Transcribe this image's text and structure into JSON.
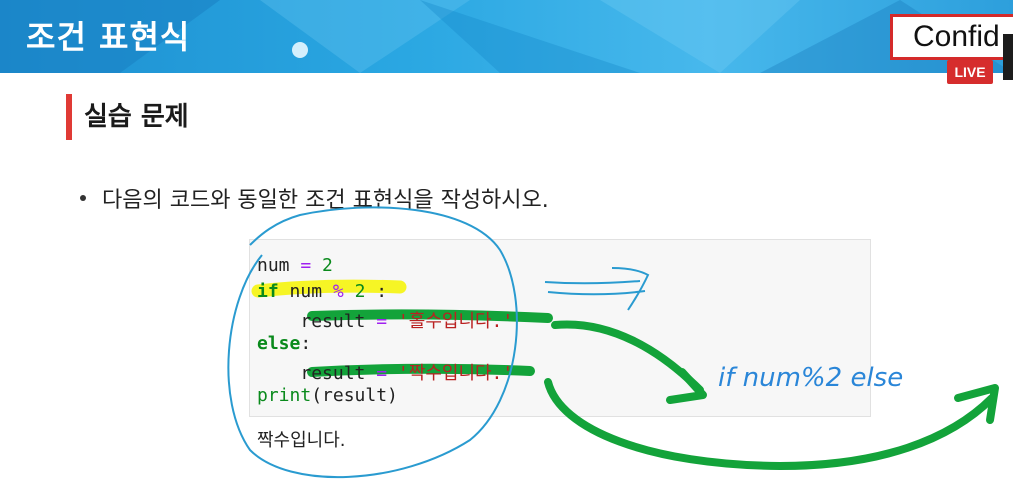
{
  "header": {
    "title": "조건 표현식",
    "confidential_text": "Confid",
    "live_badge": "LIVE"
  },
  "section": {
    "title": "실습 문제"
  },
  "bullet": {
    "text": "다음의 코드와 동일한 조건 표현식을 작성하시오."
  },
  "code": {
    "line1": {
      "var": "num",
      "op": "=",
      "value": "2"
    },
    "line2": {
      "kw": "if",
      "expr": "num",
      "op": "%",
      "value": "2",
      "end": ":"
    },
    "line3": {
      "var": "result",
      "op": "=",
      "str": "'홀수입니다.'"
    },
    "line4": {
      "kw": "else",
      "end": ":"
    },
    "line5": {
      "var": "result",
      "op": "=",
      "str": "'짝수입니다.'"
    },
    "line6": {
      "fn": "print",
      "args": "(result)"
    }
  },
  "output": "짝수입니다.",
  "annotation": {
    "handwritten": "if num%2 else"
  },
  "colors": {
    "header_blue": "#2aa7e2",
    "accent_red": "#e03a35",
    "keyword_green": "#0a8a1c",
    "operator_purple": "#a020f0",
    "string_red": "#ba2121",
    "highlight_yellow": "#f6f400",
    "marker_green": "#13a33a",
    "pen_blue": "#2a86d8"
  }
}
